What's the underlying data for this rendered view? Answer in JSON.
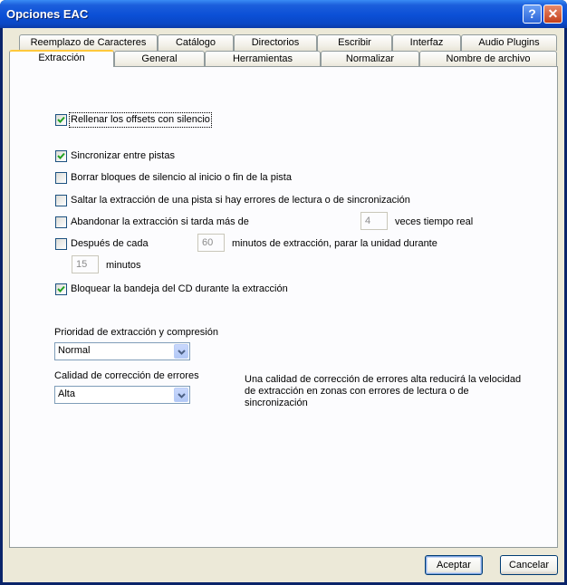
{
  "window": {
    "title": "Opciones EAC",
    "help_glyph": "?",
    "close_glyph": "✕"
  },
  "tabs_row1": [
    "Reemplazo de Caracteres",
    "Catálogo",
    "Directorios",
    "Escribir",
    "Interfaz",
    "Audio Plugins"
  ],
  "tabs_row2": [
    "Extracción",
    "General",
    "Herramientas",
    "Normalizar",
    "Nombre de archivo"
  ],
  "options": {
    "fill_offsets": {
      "label": "Rellenar los offsets con silencio",
      "checked": true
    },
    "sync_tracks": {
      "label": "Sincronizar entre pistas",
      "checked": true
    },
    "delete_silence": {
      "label": "Borrar bloques de silencio al inicio o fin de la pista",
      "checked": false
    },
    "skip_errors": {
      "label": "Saltar la extracción de una pista si hay errores de lectura o de sincronización",
      "checked": false
    },
    "abandon_slow": {
      "label": "Abandonar la extracción si tarda más de",
      "checked": false,
      "value": "4",
      "suffix": "veces tiempo real"
    },
    "after_each": {
      "label": "Después de cada",
      "checked": false,
      "value": "60",
      "suffix": "minutos de extracción, parar la unidad durante",
      "pause_value": "15",
      "pause_suffix": "minutos"
    },
    "lock_tray": {
      "label": "Bloquear la bandeja del CD durante la extracción",
      "checked": true
    }
  },
  "priority": {
    "label": "Prioridad de extracción y compresión",
    "value": "Normal"
  },
  "quality": {
    "label": "Calidad de corrección de errores",
    "value": "Alta",
    "note": "Una calidad de corrección de errores alta reducirá la velocidad de extracción en zonas con errores de lectura o de sincronización"
  },
  "buttons": {
    "ok": "Aceptar",
    "cancel": "Cancelar"
  },
  "colors": {
    "title_bar": "#0b4fd6",
    "dialog_bg": "#ece9d8",
    "active_tab_accent": "#ffc83c",
    "check_mark": "#21a121"
  }
}
